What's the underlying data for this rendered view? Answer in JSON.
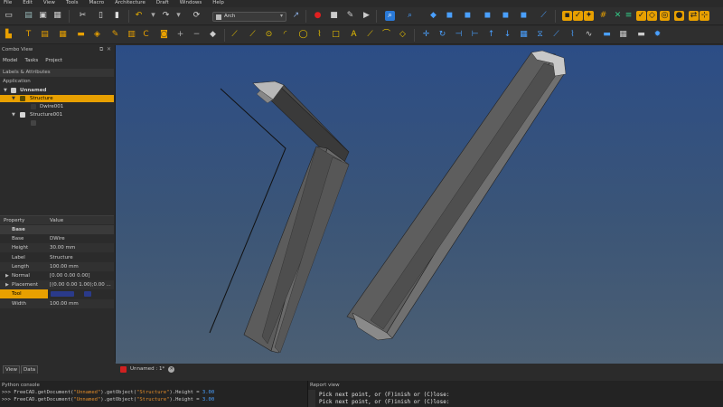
{
  "menu": [
    "File",
    "Edit",
    "View",
    "Tools",
    "Macro",
    "Architecture",
    "Draft",
    "Windows",
    "Help"
  ],
  "workbench": {
    "selected": "Arch"
  },
  "combo_view": {
    "title": "Combo View",
    "tabs": [
      "Model",
      "Tasks",
      "Project"
    ],
    "labels_header": "Labels & Attributes",
    "application_label": "Application",
    "tree": [
      {
        "label": "Unnamed",
        "level": 0,
        "expanded": true
      },
      {
        "label": "Structure",
        "level": 1,
        "selected": true
      },
      {
        "label": "Dwire001",
        "level": 2
      },
      {
        "label": "Structure001",
        "level": 1,
        "expanded": true
      },
      {
        "label": "",
        "level": 2
      }
    ]
  },
  "properties": {
    "header_property": "Property",
    "header_value": "Value",
    "rows": [
      {
        "name": "Base",
        "value": "",
        "group": true
      },
      {
        "name": "Base",
        "value": "DWire"
      },
      {
        "name": "Height",
        "value": "30.00 mm"
      },
      {
        "name": "Label",
        "value": "Structure"
      },
      {
        "name": "Length",
        "value": "100.00 mm"
      },
      {
        "name": "Normal",
        "value": "[0.00 0.00 0.00]",
        "expandable": true
      },
      {
        "name": "Placement",
        "value": "[(0.00 0.00 1.00);0.00 ...",
        "expandable": true
      },
      {
        "name": "Tool",
        "value": "",
        "selected": true
      },
      {
        "name": "Width",
        "value": "100.00 mm"
      }
    ]
  },
  "bottom_tabs": [
    "View",
    "Data"
  ],
  "document_tab": {
    "label": "Unnamed : 1*"
  },
  "python_console": {
    "title": "Python console",
    "lines": [
      {
        "prefix": ">>> FreeCAD.getDocument(",
        "doc": "\"Unnamed\"",
        "mid": ").getObject(",
        "obj": "\"Structure\"",
        "suffix": ").Height = ",
        "value": "3.00"
      },
      {
        "prefix": ">>> FreeCAD.getDocument(",
        "doc": "\"Unnamed\"",
        "mid": ").getObject(",
        "obj": "\"Structure\"",
        "suffix": ").Height = ",
        "value": "3.00"
      }
    ]
  },
  "report_view": {
    "title": "Report view",
    "lines": [
      "Pick next point, or (F)inish or (C)lose:",
      "Pick next point, or (F)inish or (C)lose:"
    ]
  },
  "colors": {
    "selection": "#e8a000",
    "viewport_top": "#2c4d86",
    "viewport_bottom": "#4c5f73",
    "beam": "#5a5a5a"
  }
}
